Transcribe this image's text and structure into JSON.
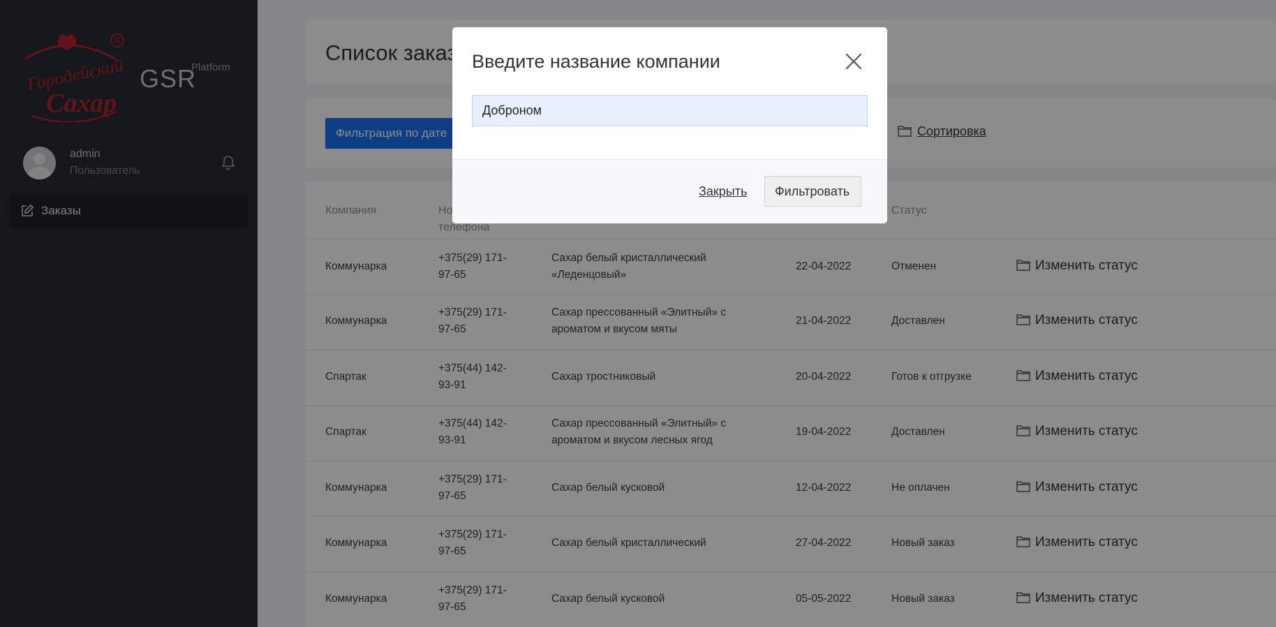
{
  "sidebar": {
    "logo_text": "Городейский Сахар",
    "brand": "GSR",
    "brand_sub": "Platform",
    "user": {
      "name": "admin",
      "role": "Пользователь"
    },
    "nav": [
      {
        "label": "Заказы",
        "icon": "edit-icon"
      }
    ]
  },
  "main": {
    "page_title": "Список заказов",
    "filter_date_button": "Фильтрация по дате",
    "sort_link": "Сортировка",
    "table": {
      "headers": {
        "company": "Компания",
        "phone": "Номер телефона",
        "status": "Статус"
      },
      "rows": [
        {
          "company": "Коммунарка",
          "phone": "+375(29) 171-97-65",
          "product": "Сахар белый кристаллический «Леденцовый»",
          "date": "22-04-2022",
          "status": "Отменен",
          "action": "Изменить статус"
        },
        {
          "company": "Коммунарка",
          "phone": "+375(29) 171-97-65",
          "product": "Сахар прессованный «Элитный» с ароматом и вкусом мяты",
          "date": "21-04-2022",
          "status": "Доставлен",
          "action": "Изменить статус"
        },
        {
          "company": "Спартак",
          "phone": "+375(44) 142-93-91",
          "product": "Сахар тростниковый",
          "date": "20-04-2022",
          "status": "Готов к отгрузке",
          "action": "Изменить статус"
        },
        {
          "company": "Спартак",
          "phone": "+375(44) 142-93-91",
          "product": "Сахар прессованный «Элитный» с ароматом и вкусом лесных ягод",
          "date": "19-04-2022",
          "status": "Доставлен",
          "action": "Изменить статус"
        },
        {
          "company": "Коммунарка",
          "phone": "+375(29) 171-97-65",
          "product": "Сахар белый кусковой",
          "date": "12-04-2022",
          "status": "Не оплачен",
          "action": "Изменить статус"
        },
        {
          "company": "Коммунарка",
          "phone": "+375(29) 171-97-65",
          "product": "Сахар белый кристаллический",
          "date": "27-04-2022",
          "status": "Новый заказ",
          "action": "Изменить статус"
        },
        {
          "company": "Коммунарка",
          "phone": "+375(29) 171-97-65",
          "product": "Сахар белый кусковой",
          "date": "05-05-2022",
          "status": "Новый заказ",
          "action": "Изменить статус"
        }
      ]
    }
  },
  "modal": {
    "title": "Введите название компании",
    "input_value": "Доброном",
    "close_label": "Закрыть",
    "filter_label": "Фильтровать"
  },
  "colors": {
    "sidebar": "#272b33",
    "accent": "#1b6ff0",
    "logo": "#b5232f"
  }
}
